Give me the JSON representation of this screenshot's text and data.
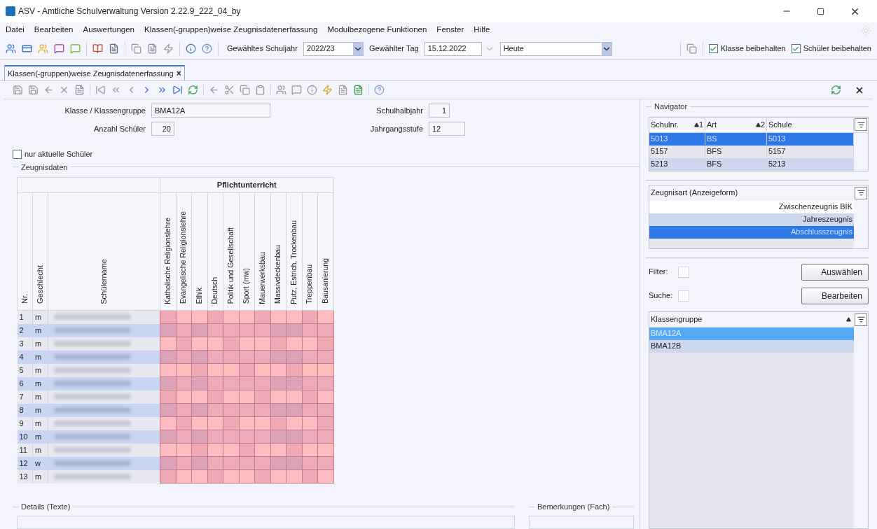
{
  "window": {
    "title": "ASV - Amtliche Schulverwaltung Version 2.22.9_222_04_by"
  },
  "menu": [
    {
      "label": "Datei"
    },
    {
      "label": "Bearbeiten"
    },
    {
      "label": "Auswertungen"
    },
    {
      "label": "Klassen(-gruppen)weise Zeugnisdatenerfassung"
    },
    {
      "label": "Modulbezogene Funktionen"
    },
    {
      "label": "Fenster"
    },
    {
      "label": "Hilfe"
    }
  ],
  "toolbar": {
    "schuljahr_label": "Gewähltes Schuljahr",
    "schuljahr": "2022/23",
    "tag_label": "Gewählter Tag",
    "tag": "15.12.2022",
    "heute": "Heute",
    "checkboxes": [
      {
        "label": "Klasse beibehalten",
        "checked": true
      },
      {
        "label": "Schüler beibehalten",
        "checked": true
      }
    ]
  },
  "tab": {
    "label": "Klassen(-gruppen)weise Zeugnisdatenerfassung",
    "selected": true,
    "close": "×"
  },
  "form": {
    "klasse_label": "Klasse / Klassengruppe",
    "klasse": "BMA12A",
    "anzahl_label": "Anzahl Schüler",
    "anzahl": "20",
    "halbjahr_label": "Schulhalbjahr",
    "halbjahr": "1",
    "stufe_label": "Jahrgangsstufe",
    "stufe": "12",
    "nur_aktuelle": {
      "label": "nur aktuelle Schüler",
      "checked": false
    }
  },
  "zeugnisdaten": {
    "title": "Zeugnisdaten",
    "group_header": "Pflichtunterricht",
    "columns": [
      "Nr.",
      "Geschlecht",
      "Schülername"
    ],
    "subjects": [
      "Katholische Religionslehre",
      "Evangelische Religionslehre",
      "Ethik",
      "Deutsch",
      "Politik und Gesellschaft",
      "Sport (mw)",
      "Mauerwerksbau",
      "Massivdeckenbau",
      "Putz, Estrich, Trockenbau",
      "Treppenbau",
      "Bausanierung"
    ],
    "rows": [
      {
        "nr": "1",
        "geschlecht": "m"
      },
      {
        "nr": "2",
        "geschlecht": "m"
      },
      {
        "nr": "3",
        "geschlecht": "m"
      },
      {
        "nr": "4",
        "geschlecht": "m"
      },
      {
        "nr": "5",
        "geschlecht": "m"
      },
      {
        "nr": "6",
        "geschlecht": "m"
      },
      {
        "nr": "7",
        "geschlecht": "m"
      },
      {
        "nr": "8",
        "geschlecht": "m"
      },
      {
        "nr": "9",
        "geschlecht": "m"
      },
      {
        "nr": "10",
        "geschlecht": "m"
      },
      {
        "nr": "11",
        "geschlecht": "m"
      },
      {
        "nr": "12",
        "geschlecht": "w"
      },
      {
        "nr": "13",
        "geschlecht": "m"
      }
    ]
  },
  "details": {
    "title": "Details (Texte)",
    "bemerkungen": "Bemerkungen (Fach)"
  },
  "navigator": {
    "title": "Navigator",
    "columns": [
      {
        "label": "Schulnr.",
        "sort": "1"
      },
      {
        "label": "Art",
        "sort": "2"
      },
      {
        "label": "Schule"
      }
    ],
    "rows": [
      {
        "cells": [
          "5013",
          "BS",
          "5013"
        ],
        "selected": true
      },
      {
        "cells": [
          "5157",
          "BFS",
          "5157"
        ],
        "selected": false
      },
      {
        "cells": [
          "5213",
          "BFS",
          "5213"
        ],
        "selected": false
      }
    ]
  },
  "zeugnisart": {
    "header": "Zeugnisart (Anzeigeform)",
    "items": [
      {
        "label": "Zwischenzeugnis BIK",
        "selected": false
      },
      {
        "label": "Jahreszeugnis",
        "selected": false
      },
      {
        "label": "Abschlusszeugnis",
        "selected": true
      }
    ]
  },
  "filter": {
    "label": "Filter:",
    "checked": false,
    "button": "Auswählen"
  },
  "suche": {
    "label": "Suche:",
    "checked": false,
    "button": "Bearbeiten"
  },
  "klassengruppe": {
    "header": "Klassengruppe",
    "items": [
      {
        "label": "BMA12A",
        "selected": true
      },
      {
        "label": "BMA12B",
        "selected": false
      }
    ]
  }
}
